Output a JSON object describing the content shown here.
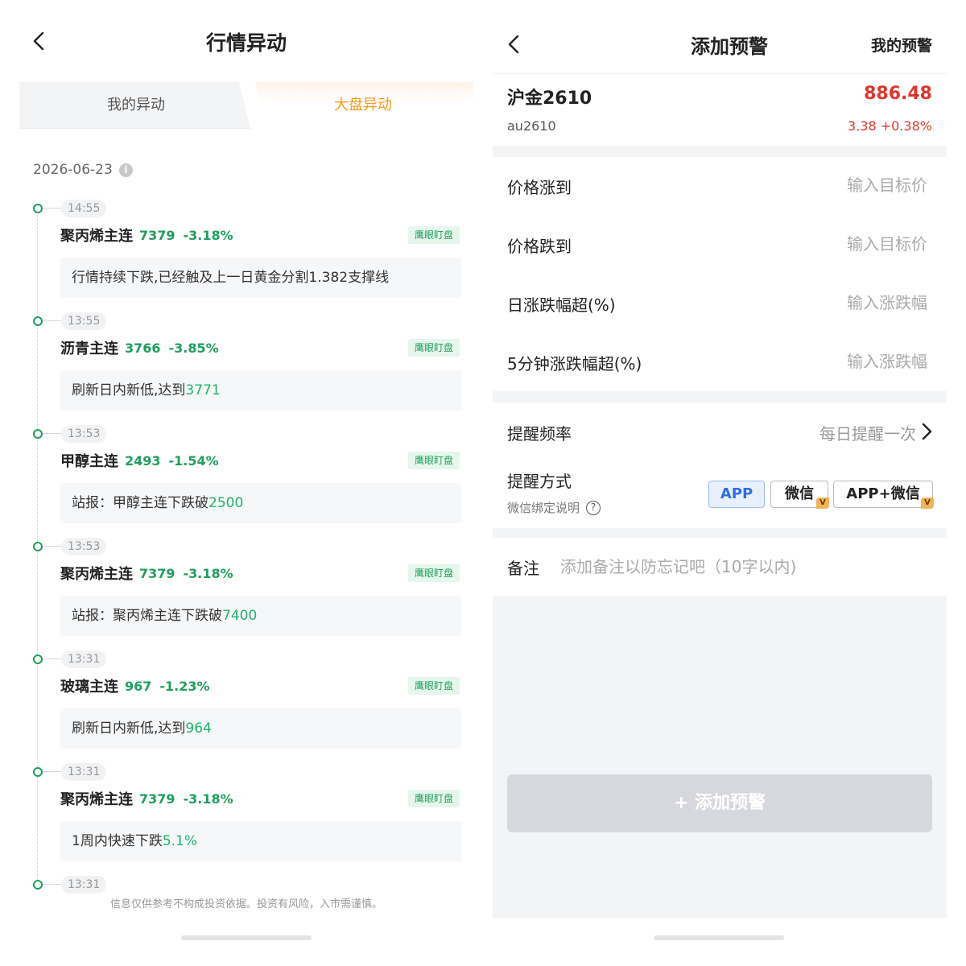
{
  "left": {
    "title": "行情异动",
    "tabs": [
      {
        "label": "我的异动",
        "active": false
      },
      {
        "label": "大盘异动",
        "active": true
      }
    ],
    "date": "2026-06-23",
    "entries": [
      {
        "time": "14:55",
        "name": "聚丙烯主连",
        "price": "7379",
        "change": "-3.18%",
        "tag": "鹰眼盯盘",
        "desc": "行情持续下跌,已经触及上一日黄金分割1.382支撑线",
        "highlight": ""
      },
      {
        "time": "13:55",
        "name": "沥青主连",
        "price": "3766",
        "change": "-3.85%",
        "tag": "鹰眼盯盘",
        "desc": "刷新日内新低,达到",
        "highlight": "3771"
      },
      {
        "time": "13:53",
        "name": "甲醇主连",
        "price": "2493",
        "change": "-1.54%",
        "tag": "鹰眼盯盘",
        "desc": "站报：甲醇主连下跌破",
        "highlight": "2500"
      },
      {
        "time": "13:53",
        "name": "聚丙烯主连",
        "price": "7379",
        "change": "-3.18%",
        "tag": "鹰眼盯盘",
        "desc": "站报：聚丙烯主连下跌破",
        "highlight": "7400"
      },
      {
        "time": "13:31",
        "name": "玻璃主连",
        "price": "967",
        "change": "-1.23%",
        "tag": "鹰眼盯盘",
        "desc": "刷新日内新低,达到",
        "highlight": "964"
      },
      {
        "time": "13:31",
        "name": "聚丙烯主连",
        "price": "7379",
        "change": "-3.18%",
        "tag": "鹰眼盯盘",
        "desc": "1周内快速下跌",
        "highlight": "5.1%"
      }
    ],
    "last_time": "13:31",
    "disclaimer": "信息仅供参考不构成投资依据。投资有风险，入市需谨慎。"
  },
  "right": {
    "title": "添加预警",
    "my_alerts": "我的预警",
    "quote": {
      "name": "沪金2610",
      "code": "au2610",
      "price": "886.48",
      "change": "3.38 +0.38%"
    },
    "fields": [
      {
        "label": "价格涨到",
        "placeholder": "输入目标价",
        "value": ""
      },
      {
        "label": "价格跌到",
        "placeholder": "输入目标价",
        "value": ""
      },
      {
        "label": "日涨跌幅超(%)",
        "placeholder": "输入涨跌幅",
        "value": ""
      },
      {
        "label": "5分钟涨跌幅超(%)",
        "placeholder": "输入涨跌幅",
        "value": ""
      }
    ],
    "frequency": {
      "label": "提醒频率",
      "value": "每日提醒一次"
    },
    "method": {
      "label": "提醒方式",
      "note": "微信绑定说明",
      "options": [
        {
          "label": "APP",
          "selected": true,
          "vip": false
        },
        {
          "label": "微信",
          "selected": false,
          "vip": true
        },
        {
          "label": "APP+微信",
          "selected": false,
          "vip": true
        }
      ],
      "vip_badge": "V"
    },
    "note": {
      "label": "备注",
      "placeholder": "添加备注以防忘记吧（10字以内)"
    },
    "submit_label": "+ 添加预警"
  },
  "colors": {
    "up": "#e0352b",
    "down": "#1f9e5c",
    "accent_orange": "#f29a1a",
    "selected_blue": "#2e6ee0"
  }
}
